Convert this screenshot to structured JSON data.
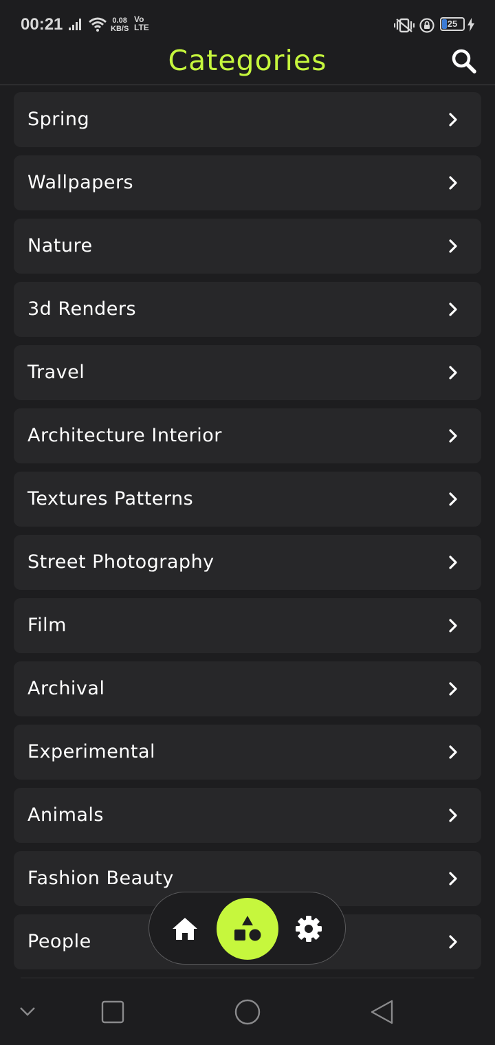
{
  "status_bar": {
    "time": "00:21",
    "net_speed_value": "0.08",
    "net_speed_unit": "KB/S",
    "volte_top": "Vo",
    "volte_bottom": "LTE",
    "battery": "25"
  },
  "header": {
    "title": "Categories",
    "search_icon": "search-icon"
  },
  "categories": [
    {
      "label": "Spring"
    },
    {
      "label": "Wallpapers"
    },
    {
      "label": "Nature"
    },
    {
      "label": "3d Renders"
    },
    {
      "label": "Travel"
    },
    {
      "label": "Architecture Interior"
    },
    {
      "label": "Textures Patterns"
    },
    {
      "label": "Street Photography"
    },
    {
      "label": "Film"
    },
    {
      "label": "Archival"
    },
    {
      "label": "Experimental"
    },
    {
      "label": "Animals"
    },
    {
      "label": "Fashion Beauty"
    },
    {
      "label": "People"
    }
  ],
  "bottom_nav": {
    "items": [
      "home-icon",
      "shapes-icon",
      "settings-icon"
    ],
    "active": "shapes-icon"
  },
  "system_nav": {
    "items": [
      "chevron-down-icon",
      "recents-icon",
      "home-circle-icon",
      "back-icon"
    ]
  },
  "colors": {
    "accent": "#c6f73d",
    "background": "#1d1d1f",
    "card": "#272729",
    "text": "#ffffff"
  }
}
